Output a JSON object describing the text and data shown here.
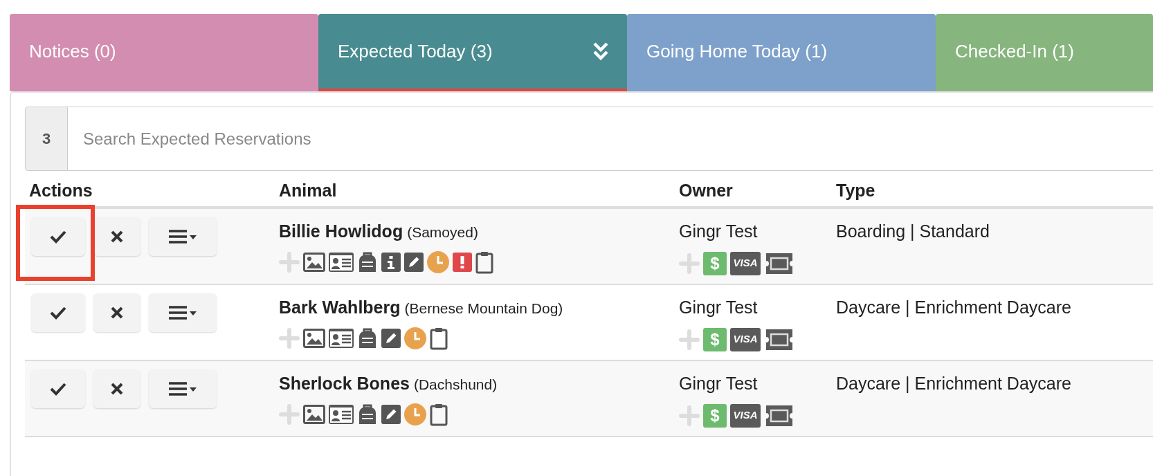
{
  "tabs": [
    {
      "label": "Notices (0)",
      "color": "#d38db0",
      "selected": false,
      "collapse_icon": false
    },
    {
      "label": "Expected Today (3)",
      "color": "#488b90",
      "selected": true,
      "collapse_icon": true
    },
    {
      "label": "Going Home Today (1)",
      "color": "#7ea1cb",
      "selected": false,
      "collapse_icon": false
    },
    {
      "label": "Checked-In (1)",
      "color": "#86b57e",
      "selected": false,
      "collapse_icon": false
    }
  ],
  "search": {
    "count": "3",
    "placeholder": "Search Expected Reservations"
  },
  "table": {
    "columns": [
      "Actions",
      "Animal",
      "Owner",
      "Type"
    ],
    "rows": [
      {
        "highlighted": true,
        "animal": "Billie Howlidog",
        "breed": "(Samoyed)",
        "animal_icons": [
          {
            "kind": "add"
          },
          {
            "kind": "photo"
          },
          {
            "kind": "id-card"
          },
          {
            "kind": "backpack"
          },
          {
            "kind": "info"
          },
          {
            "kind": "edit"
          },
          {
            "kind": "clock"
          },
          {
            "kind": "alert"
          },
          {
            "kind": "clipboard"
          }
        ],
        "owner": "Gingr Test",
        "balance_badge": "$",
        "card_badge": "VISA",
        "type": "Boarding | Standard"
      },
      {
        "highlighted": false,
        "animal": "Bark Wahlberg",
        "breed": "(Bernese Mountain Dog)",
        "animal_icons": [
          {
            "kind": "add"
          },
          {
            "kind": "photo"
          },
          {
            "kind": "id-card"
          },
          {
            "kind": "backpack"
          },
          {
            "kind": "edit"
          },
          {
            "kind": "clock"
          },
          {
            "kind": "clipboard"
          }
        ],
        "owner": "Gingr Test",
        "balance_badge": "$",
        "card_badge": "VISA",
        "type": "Daycare | Enrichment Daycare"
      },
      {
        "highlighted": false,
        "animal": "Sherlock Bones",
        "breed": "(Dachshund)",
        "animal_icons": [
          {
            "kind": "add"
          },
          {
            "kind": "photo"
          },
          {
            "kind": "id-card"
          },
          {
            "kind": "backpack"
          },
          {
            "kind": "edit"
          },
          {
            "kind": "clock"
          },
          {
            "kind": "clipboard"
          }
        ],
        "owner": "Gingr Test",
        "balance_badge": "$",
        "card_badge": "VISA",
        "type": "Daycare | Enrichment Daycare"
      }
    ]
  }
}
